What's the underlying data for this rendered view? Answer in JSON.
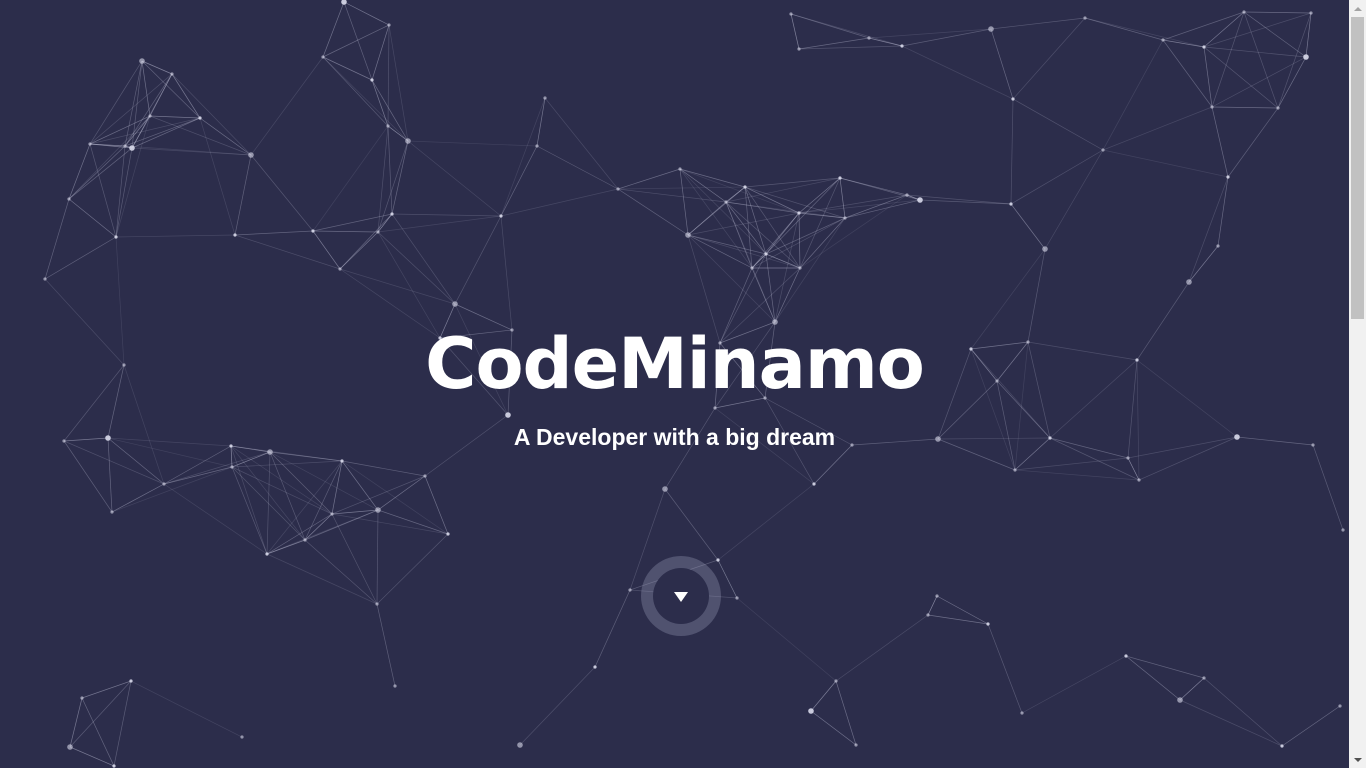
{
  "hero": {
    "title": "CodeMinamo",
    "subtitle": "A Developer with a big dream"
  },
  "scroll_button": {
    "icon": "triangle-down"
  },
  "colors": {
    "background": "#2c2d4b",
    "text": "#ffffff",
    "network": "#c9cae0"
  },
  "scrollbar": {
    "thumb_fraction": 0.39
  }
}
